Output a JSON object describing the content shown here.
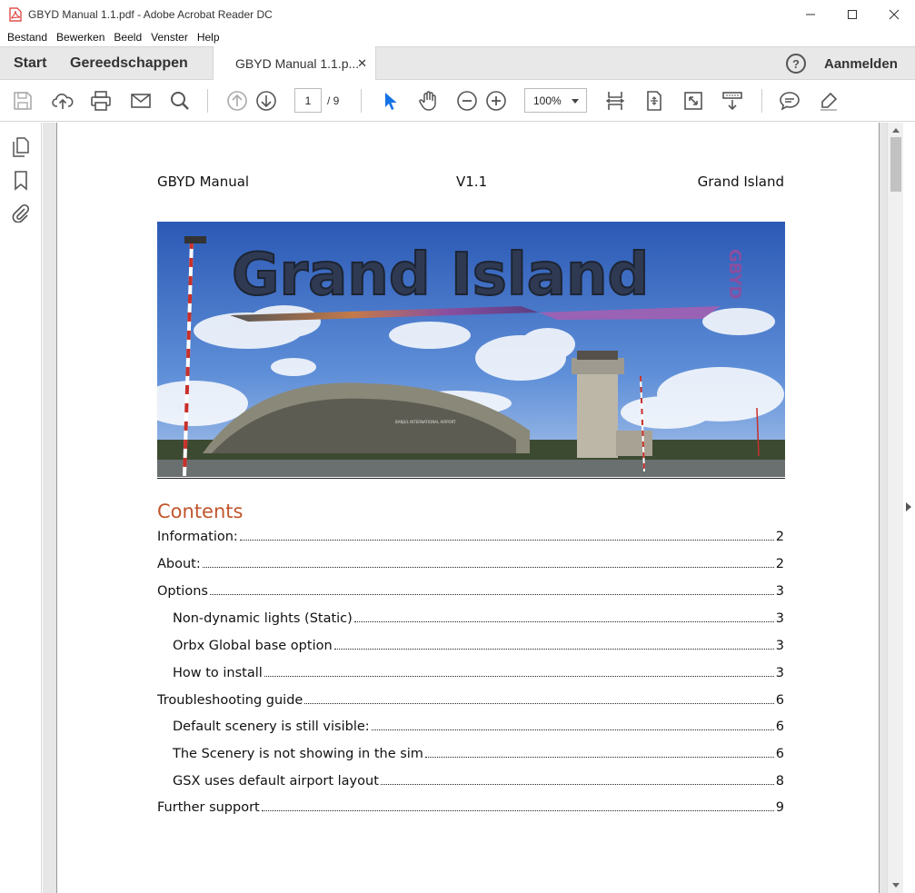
{
  "window": {
    "title": "GBYD Manual 1.1.pdf - Adobe Acrobat Reader DC",
    "controls": [
      "minimize",
      "maximize",
      "close"
    ]
  },
  "menu": [
    "Bestand",
    "Bewerken",
    "Beeld",
    "Venster",
    "Help"
  ],
  "tabs": {
    "home": "Start",
    "tools": "Gereedschappen",
    "document": "GBYD Manual 1.1.p...",
    "close_glyph": "✕",
    "help_glyph": "?",
    "signin": "Aanmelden"
  },
  "toolbar": {
    "page_current": "1",
    "page_total": "/  9",
    "zoom": "100%"
  },
  "document": {
    "header_left": "GBYD Manual",
    "header_center": "V1.1",
    "header_right": "Grand Island",
    "banner": {
      "title": "Grand Island",
      "code": "GBYD",
      "building_sign": "BANJUL INTERNATIONAL AIRPORT"
    },
    "toc_title": "Contents",
    "toc": [
      {
        "label": "Information:",
        "page": "2",
        "level": 1
      },
      {
        "label": "About:",
        "page": "2",
        "level": 1
      },
      {
        "label": "Options",
        "page": "3",
        "level": 1
      },
      {
        "label": "Non-dynamic lights (Static)",
        "page": "3",
        "level": 2
      },
      {
        "label": "Orbx Global base option",
        "page": "3",
        "level": 2
      },
      {
        "label": "How to install",
        "page": "3",
        "level": 2
      },
      {
        "label": "Troubleshooting guide",
        "page": "6",
        "level": 1
      },
      {
        "label": "Default scenery is still visible:",
        "page": "6",
        "level": 2
      },
      {
        "label": "The Scenery is not showing in the sim",
        "page": "6",
        "level": 2
      },
      {
        "label": "GSX uses default airport layout",
        "page": "8",
        "level": 2
      },
      {
        "label": "Further support",
        "page": "9",
        "level": 1
      }
    ]
  },
  "colors": {
    "toc_heading": "#c0562d",
    "select_tool": "#1473e6",
    "pdf_icon": "#d9322b"
  }
}
